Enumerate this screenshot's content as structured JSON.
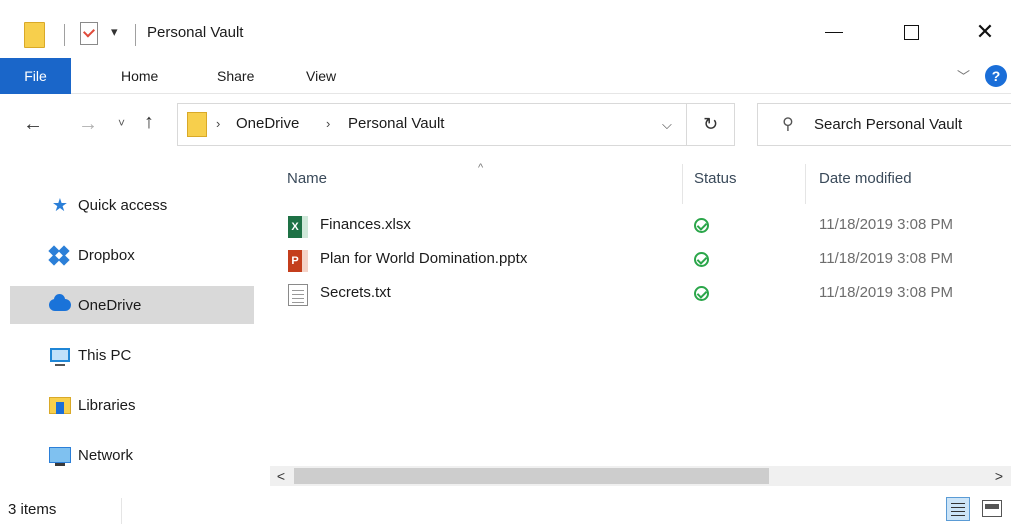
{
  "window": {
    "title": "Personal Vault",
    "dropdown_glyph": "▾",
    "minimize_glyph": "",
    "close_glyph": "✕"
  },
  "ribbon": {
    "tabs": [
      {
        "label": "File"
      },
      {
        "label": "Home"
      },
      {
        "label": "Share"
      },
      {
        "label": "View"
      }
    ],
    "collapse_glyph": "﹀",
    "help_label": "?"
  },
  "nav": {
    "back_glyph": "←",
    "forward_glyph": "→",
    "recent_glyph": "˅",
    "up_glyph": "↑",
    "path": [
      "OneDrive",
      "Personal Vault"
    ],
    "path_separator": "›",
    "path_dropdown_glyph": "⌵",
    "refresh_glyph": "↻",
    "search_placeholder": "Search Personal Vault",
    "search_glyph": "⚲"
  },
  "sidebar": {
    "items": [
      {
        "label": "Quick access",
        "icon": "star-icon"
      },
      {
        "label": "Dropbox",
        "icon": "dropbox-icon"
      },
      {
        "label": "OneDrive",
        "icon": "cloud-icon",
        "selected": true
      },
      {
        "label": "This PC",
        "icon": "computer-icon"
      },
      {
        "label": "Libraries",
        "icon": "library-icon"
      },
      {
        "label": "Network",
        "icon": "network-icon"
      }
    ]
  },
  "files": {
    "sort_glyph": "^",
    "columns": [
      "Name",
      "Status",
      "Date modified"
    ],
    "rows": [
      {
        "name": "Finances.xlsx",
        "type": "excel",
        "icon_text": "X",
        "status": "synced",
        "date": "11/18/2019 3:08 PM"
      },
      {
        "name": "Plan for World Domination.pptx",
        "type": "powerpoint",
        "icon_text": "P",
        "status": "synced",
        "date": "11/18/2019 3:08 PM"
      },
      {
        "name": "Secrets.txt",
        "type": "text",
        "icon_text": "",
        "status": "synced",
        "date": "11/18/2019 3:08 PM"
      }
    ]
  },
  "scrollbar": {
    "left_glyph": "<",
    "right_glyph": ">"
  },
  "status": {
    "item_count": "3 items"
  },
  "colors": {
    "file_tab": "#1a66c9",
    "selected_nav": "#d9d9d9",
    "synced_green": "#2ba64a",
    "folder_yellow": "#f7cf4c"
  }
}
